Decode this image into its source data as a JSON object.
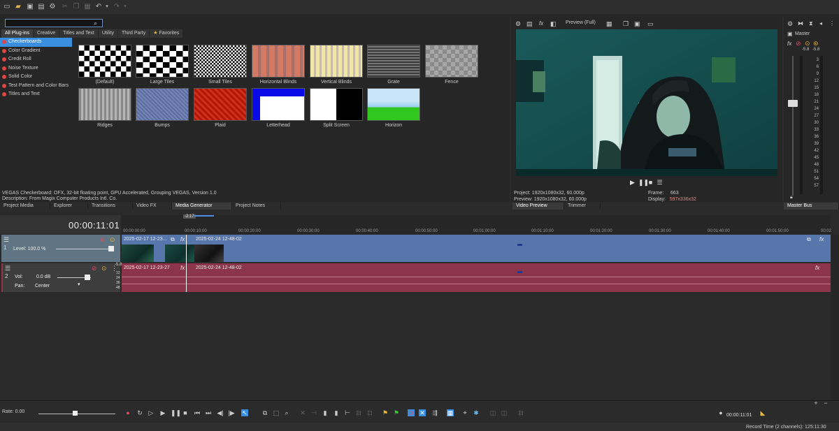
{
  "toolbar": {
    "icons": [
      "new-icon",
      "open-icon",
      "save-icon",
      "save-as-icon",
      "settings-icon",
      "cut-icon",
      "copy-icon",
      "paste-icon",
      "undo-icon",
      "redo-icon"
    ]
  },
  "media_generator": {
    "search_placeholder": "",
    "tabs": [
      "All Plug-ins",
      "Creative",
      "Titles and Text",
      "Utility",
      "Third Party",
      "Favorites"
    ],
    "list": [
      "Checkerboards",
      "Color Gradient",
      "Credit Roll",
      "Noise Texture",
      "Solid Color",
      "Test Pattern and Color Bars",
      "Titles and Text"
    ],
    "presets": [
      "(Default)",
      "Large Tiles",
      "Small Tiles",
      "Horizontal Blinds",
      "Vertical Blinds",
      "Grate",
      "Fence",
      "Ridges",
      "Bumps",
      "Plaid",
      "Letterhead",
      "Split Screen",
      "Horizon"
    ],
    "status1": "VEGAS Checkerboard: OFX, 32-bit floating point, GPU Accelerated, Grouping VEGAS, Version 1.0",
    "status2": "Description: From Magix Computer Products Intl. Co."
  },
  "window_tabs": [
    "Project Media",
    "Explorer",
    "Transitions",
    "Video FX",
    "Media Generator",
    "Project Notes"
  ],
  "preview": {
    "mode": "Preview (Full)",
    "project_label": "Project:",
    "project_value": "1920x1080x32, 60.000p",
    "preview_label": "Preview:",
    "preview_value": "1920x1080x32, 60.000p",
    "frame_label": "Frame:",
    "frame_value": "663",
    "display_label": "Display:",
    "display_value": "597x336x32",
    "tabs": [
      "Video Preview",
      "Trimmer"
    ]
  },
  "master": {
    "label": "Master",
    "db_left": "-5.8",
    "db_right": "-5.8",
    "scale": [
      "3",
      "6",
      "9",
      "12",
      "15",
      "18",
      "21",
      "24",
      "27",
      "30",
      "33",
      "36",
      "39",
      "42",
      "45",
      "48",
      "51",
      "54",
      "57"
    ],
    "tab": "Master Bus"
  },
  "timeline": {
    "current_time": "00:00:11:01",
    "marker": "-2:17",
    "ruler": [
      "00:00:00:00",
      "00:00:10:00",
      "00:00:20:00",
      "00:00:30:00",
      "00:00:40:00",
      "00:00:50:00",
      "00:01:00:00",
      "00:01:10:00",
      "00:01:20:00",
      "00:01:30:00",
      "00:01:40:00",
      "00:01:50:00",
      "00:02"
    ],
    "track1": {
      "number": "1",
      "level": "Level: 100.0 %",
      "clip_a": "2025-02-17 12-23...",
      "clip_b": "2025-02-24 12-48-02"
    },
    "track2": {
      "number": "2",
      "vol_label": "Vol:",
      "vol_value": "0.0 dB",
      "pan_label": "Pan:",
      "pan_value": "Center",
      "clip_a": "2025-02-17 12-23-27",
      "clip_b": "2025-02-24 12-48-02",
      "db_scale": [
        "12",
        "24",
        "36",
        "48"
      ],
      "db_top": "-5.8"
    }
  },
  "transport": {
    "rate": "Rate: 0.00",
    "end_time": "00:00:11:01"
  },
  "status": {
    "record": "Record Time (2 channels): 125:11:30"
  }
}
